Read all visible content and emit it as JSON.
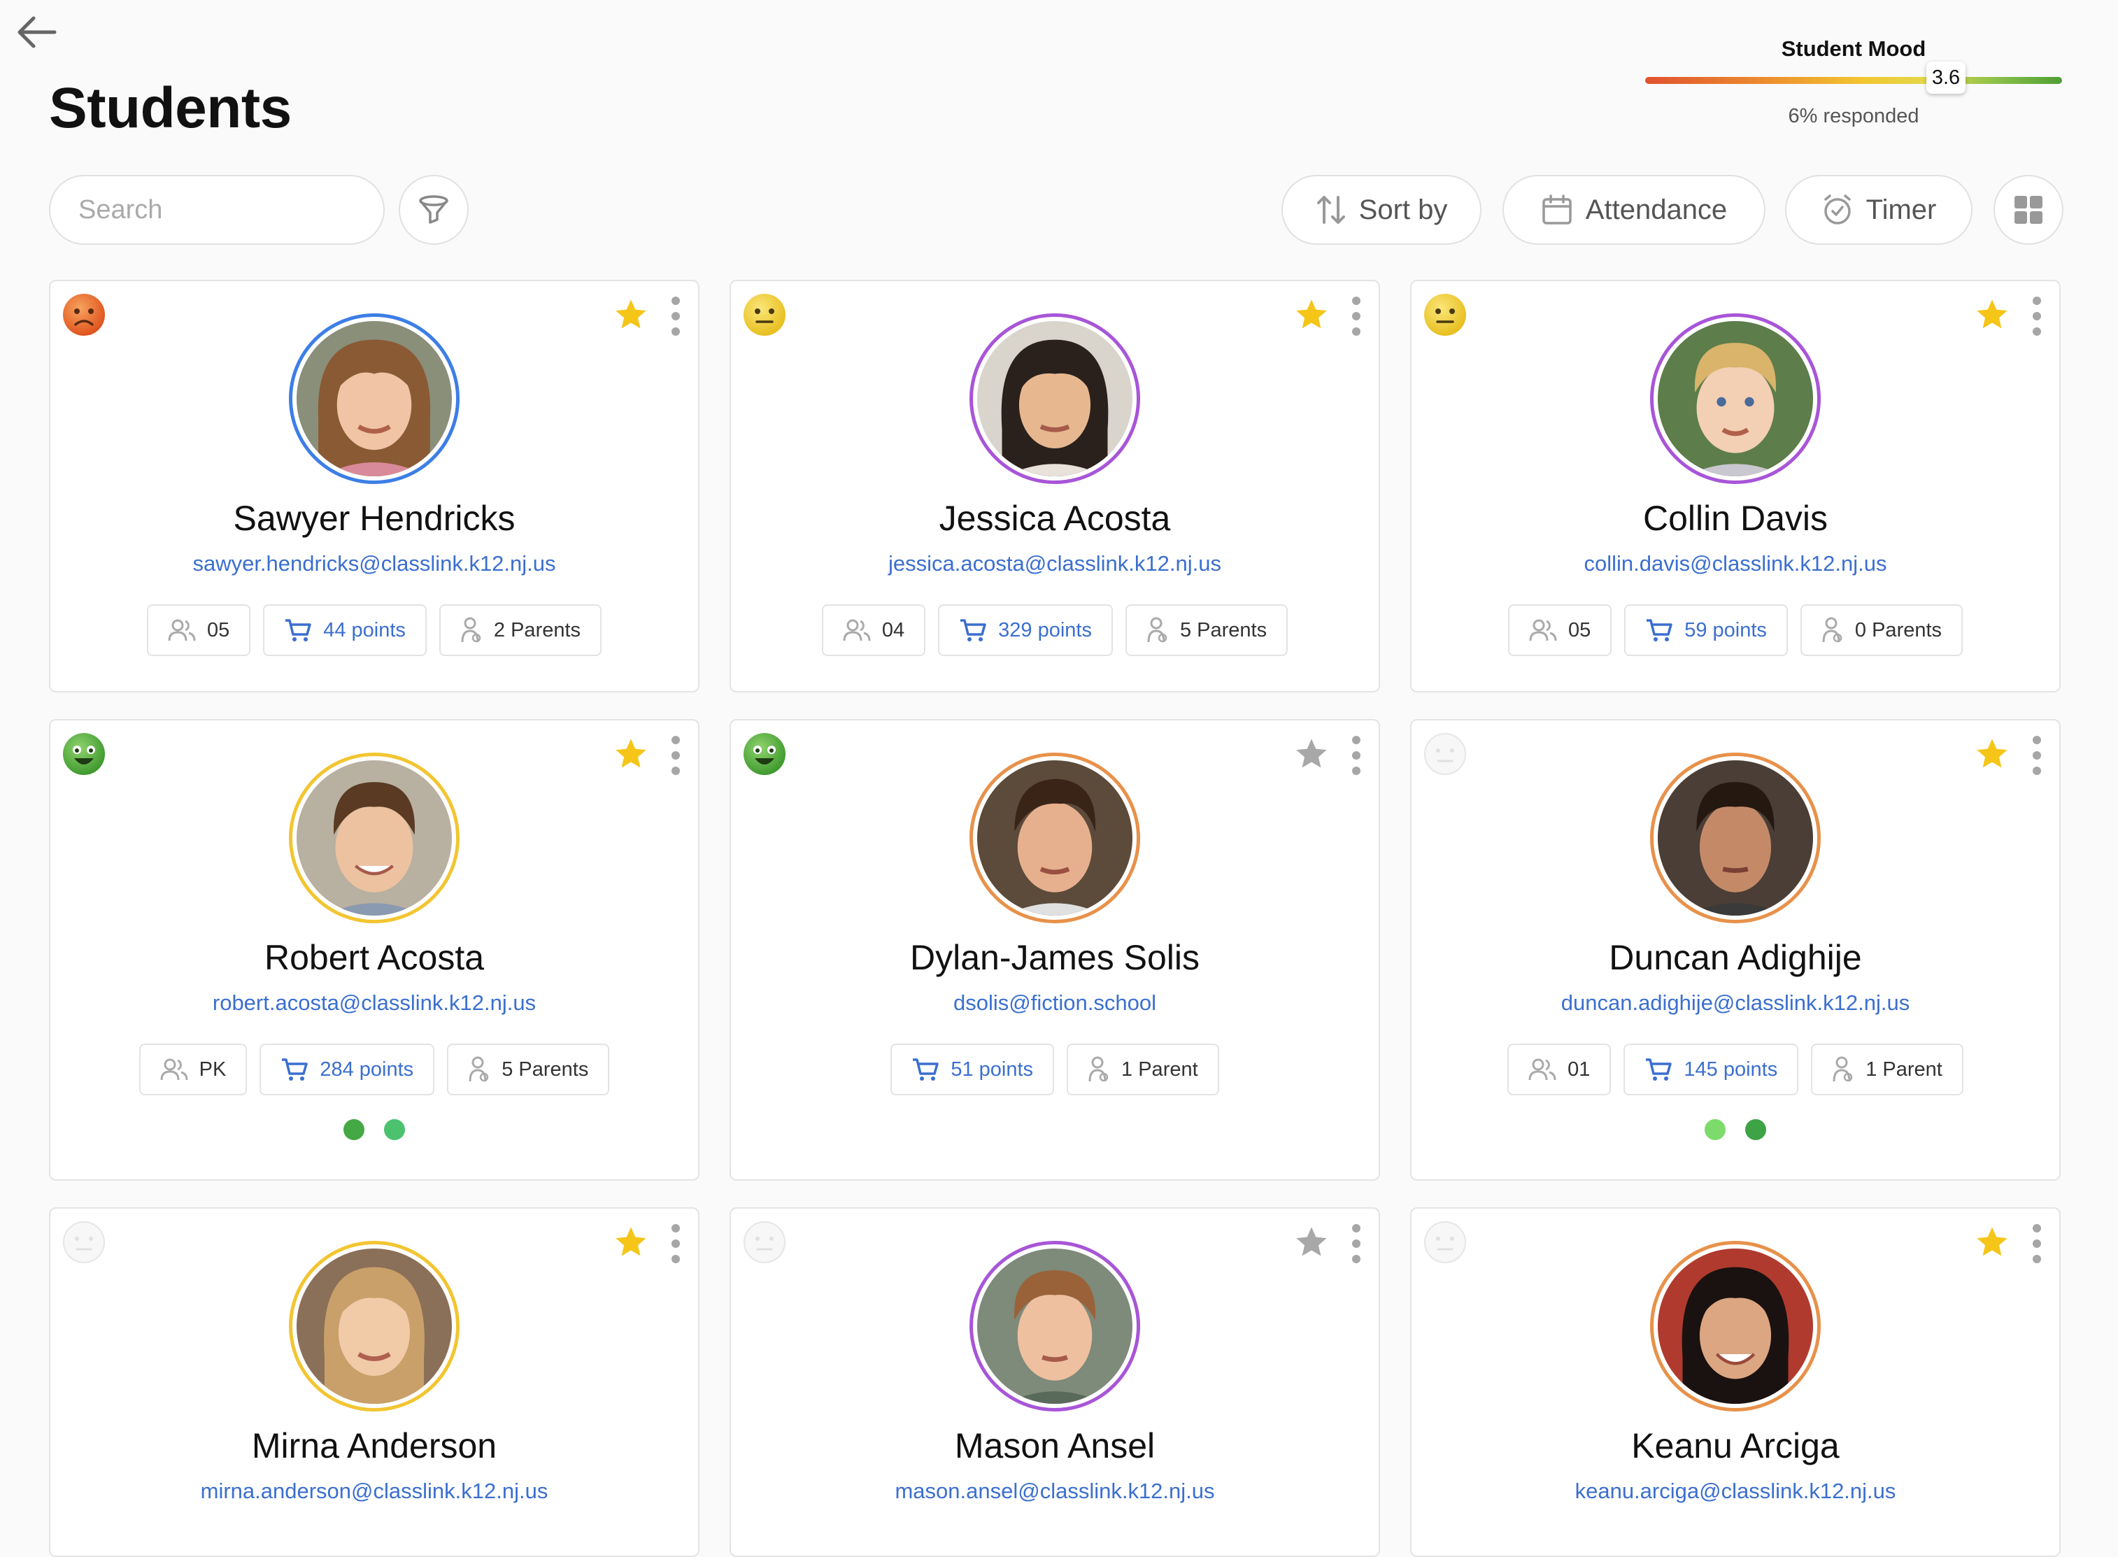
{
  "header": {
    "title": "Students"
  },
  "mood": {
    "title": "Student Mood",
    "value": "3.6",
    "responded": "6% responded"
  },
  "search": {
    "placeholder": "Search"
  },
  "toolbar": {
    "sort_label": "Sort by",
    "attendance_label": "Attendance",
    "timer_label": "Timer"
  },
  "colors": {
    "link": "#3b6fcf",
    "star_on": "#f5c518",
    "star_off": "#a8a8a8",
    "ring_blue": "#3d7ee6",
    "ring_purple": "#a855d8",
    "ring_yellow": "#f2c531",
    "ring_orange": "#e8914a"
  },
  "students": [
    {
      "name": "Sawyer Hendricks",
      "email": "sawyer.hendricks@classlink.k12.nj.us",
      "grade": "05",
      "points": "44 points",
      "parents": "2 Parents",
      "mood_icon": "sad-face-icon",
      "starred": true,
      "ring": "blue"
    },
    {
      "name": "Jessica Acosta",
      "email": "jessica.acosta@classlink.k12.nj.us",
      "grade": "04",
      "points": "329 points",
      "parents": "5 Parents",
      "mood_icon": "neutral-face-icon",
      "starred": true,
      "ring": "purple"
    },
    {
      "name": "Collin Davis",
      "email": "collin.davis@classlink.k12.nj.us",
      "grade": "05",
      "points": "59 points",
      "parents": "0 Parents",
      "mood_icon": "neutral-face-icon",
      "starred": true,
      "ring": "purple"
    },
    {
      "name": "Robert Acosta",
      "email": "robert.acosta@classlink.k12.nj.us",
      "grade": "PK",
      "points": "284 points",
      "parents": "5 Parents",
      "mood_icon": "happy-face-icon",
      "starred": true,
      "ring": "yellow",
      "indicators": [
        "#44a845",
        "#4cc26e"
      ]
    },
    {
      "name": "Dylan-James Solis",
      "email": "dsolis@fiction.school",
      "points": "51 points",
      "parents": "1 Parent",
      "mood_icon": "happy-face-icon",
      "starred": false,
      "ring": "orange"
    },
    {
      "name": "Duncan Adighije",
      "email": "duncan.adighije@classlink.k12.nj.us",
      "grade": "01",
      "points": "145 points",
      "parents": "1 Parent",
      "mood_icon": "no-mood-icon",
      "starred": true,
      "ring": "orange",
      "indicators": [
        "#7cdb6a",
        "#3ea345"
      ]
    },
    {
      "name": "Mirna Anderson",
      "email": "mirna.anderson@classlink.k12.nj.us",
      "mood_icon": "no-mood-icon",
      "starred": true,
      "ring": "yellow"
    },
    {
      "name": "Mason Ansel",
      "email": "mason.ansel@classlink.k12.nj.us",
      "mood_icon": "no-mood-icon",
      "starred": false,
      "ring": "purple"
    },
    {
      "name": "Keanu Arciga",
      "email": "keanu.arciga@classlink.k12.nj.us",
      "mood_icon": "no-mood-icon",
      "starred": true,
      "ring": "orange"
    }
  ]
}
